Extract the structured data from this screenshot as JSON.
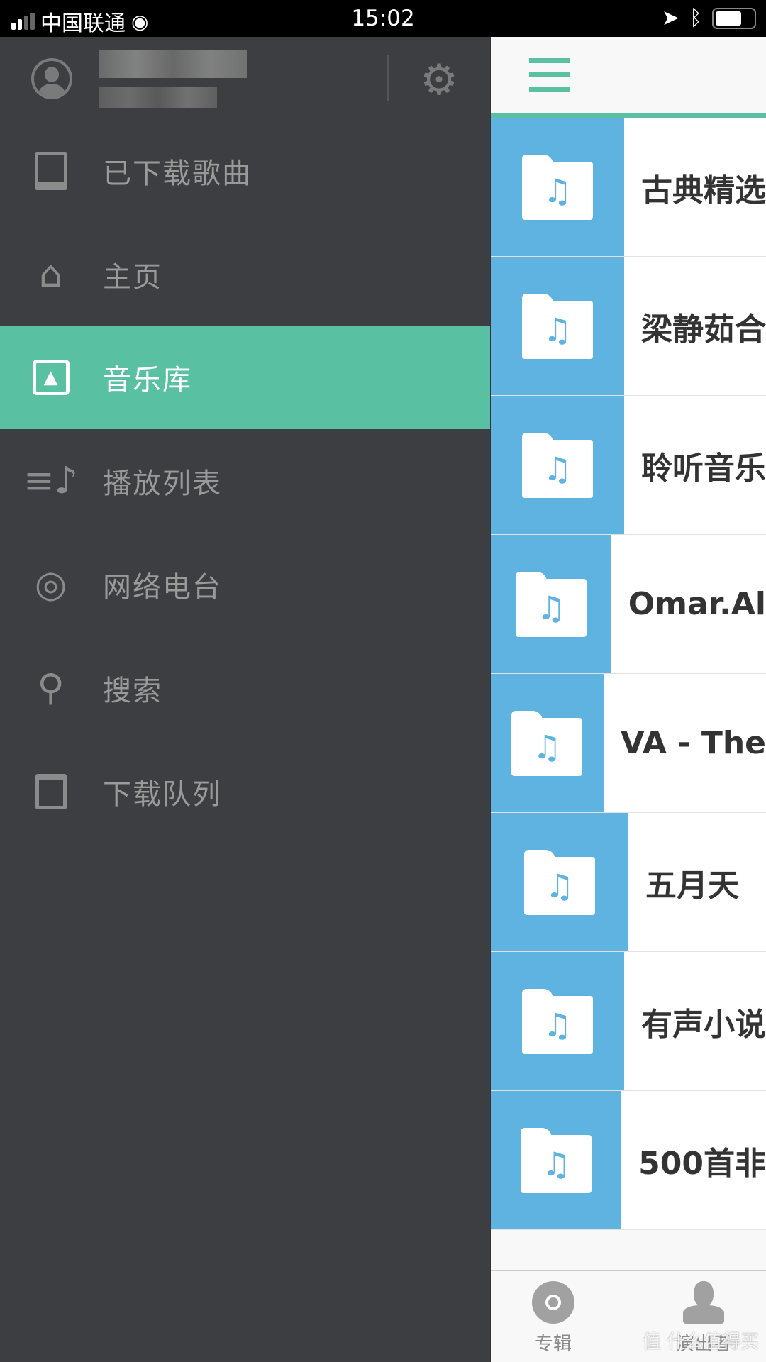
{
  "status_bar": {
    "carrier": "中国联通",
    "time": "15:02"
  },
  "drawer": {
    "menu": [
      {
        "label": "已下载歌曲",
        "icon": "tablet-icon",
        "active": false
      },
      {
        "label": "主页",
        "icon": "home-icon",
        "active": false
      },
      {
        "label": "音乐库",
        "icon": "library-icon",
        "active": true
      },
      {
        "label": "播放列表",
        "icon": "playlist-icon",
        "active": false
      },
      {
        "label": "网络电台",
        "icon": "radio-icon",
        "active": false
      },
      {
        "label": "搜索",
        "icon": "search-icon",
        "active": false
      },
      {
        "label": "下载队列",
        "icon": "clipboard-icon",
        "active": false
      }
    ]
  },
  "main": {
    "folders": [
      "古典精选",
      "梁静茹合",
      "聆听音乐",
      "Omar.Al",
      "VA - The",
      "五月天",
      "有声小说",
      "500首非"
    ],
    "tabs": [
      {
        "label": "专辑",
        "icon": "disc-icon"
      },
      {
        "label": "演出者",
        "icon": "person-icon"
      }
    ]
  },
  "watermark": "值 什么值得买",
  "colors": {
    "accent": "#5ac0a2",
    "folder_blue": "#5fb3e0",
    "drawer_bg": "#3d3e41"
  }
}
